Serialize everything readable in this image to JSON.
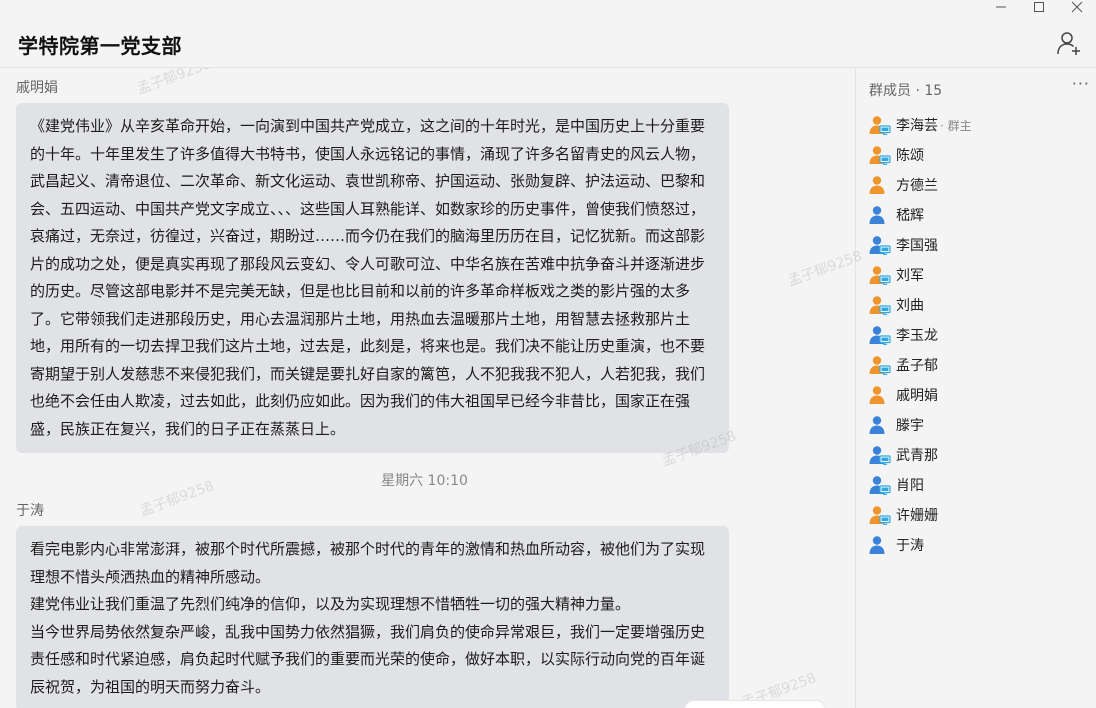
{
  "window": {
    "controls": [
      "minimize",
      "maximize",
      "close"
    ]
  },
  "header": {
    "title": "学特院第一党支部",
    "add_member_icon": "add-user-icon"
  },
  "watermark": "孟子郁9258",
  "messages": [
    {
      "sender": "戚明娟",
      "text": "《建党伟业》从辛亥革命开始，一向演到中国共产党成立，这之间的十年时光，是中国历史上十分重要的十年。十年里发生了许多值得大书特书，使国人永远铭记的事情，涌现了许多名留青史的风云人物，武昌起义、清帝退位、二次革命、新文化运动、袁世凯称帝、护国运动、张勋复辟、护法运动、巴黎和会、五四运动、中国共产党文字成立、、、这些国人耳熟能详、如数家珍的历史事件，曾使我们愤怒过，哀痛过，无奈过，彷徨过，兴奋过，期盼过……而今仍在我们的脑海里历历在目，记忆犹新。而这部影片的成功之处，便是真实再现了那段风云变幻、令人可歌可泣、中华名族在苦难中抗争奋斗并逐渐进步的历史。尽管这部电影并不是完美无缺，但是也比目前和以前的许多革命样板戏之类的影片强的太多了。它带领我们走进那段历史，用心去温润那片土地，用热血去温暖那片土地，用智慧去拯救那片土地，用所有的一切去捍卫我们这片土地，过去是，此刻是，将来也是。我们决不能让历史重演，也不要寄期望于别人发慈悲不来侵犯我们，而关键是要扎好自家的篱笆，人不犯我我不犯人，人若犯我，我们也绝不会任由人欺凌，过去如此，此刻仍应如此。因为我们的伟大祖国早已经今非昔比，国家正在强盛，民族正在复兴，我们的日子正在蒸蒸日上。"
    },
    {
      "timestamp": "星期六 10:10"
    },
    {
      "sender": "于涛",
      "text": "看完电影内心非常澎湃，被那个时代所震撼，被那个时代的青年的激情和热血所动容，被他们为了实现理想不惜头颅洒热血的精神所感动。\n建党伟业让我们重温了先烈们纯净的信仰，以及为实现理想不惜牺牲一切的强大精神力量。\n当今世界局势依然复杂严峻，乱我中国势力依然猖獗，我们肩负的使命异常艰巨，我们一定要增强历史责任感和时代紧迫感，肩负起时代赋予我们的重要而光荣的使命，做好本职，以实际行动向党的百年诞辰祝贺，为祖国的明天而努力奋斗。"
    }
  ],
  "members": {
    "header": "群成员 · 15",
    "more_label": "···",
    "list": [
      {
        "name": "李海芸",
        "role": "· 群主",
        "icon": "user-icon-orange-computer"
      },
      {
        "name": "陈颂",
        "role": "",
        "icon": "user-icon-orange-computer"
      },
      {
        "name": "方德兰",
        "role": "",
        "icon": "user-icon-orange"
      },
      {
        "name": "嵇辉",
        "role": "",
        "icon": "user-icon-blue"
      },
      {
        "name": "李国强",
        "role": "",
        "icon": "user-icon-blue-computer"
      },
      {
        "name": "刘军",
        "role": "",
        "icon": "user-icon-orange-computer"
      },
      {
        "name": "刘曲",
        "role": "",
        "icon": "user-icon-orange-computer"
      },
      {
        "name": "李玉龙",
        "role": "",
        "icon": "user-icon-blue-computer"
      },
      {
        "name": "孟子郁",
        "role": "",
        "icon": "user-icon-orange-computer"
      },
      {
        "name": "戚明娟",
        "role": "",
        "icon": "user-icon-orange"
      },
      {
        "name": "滕宇",
        "role": "",
        "icon": "user-icon-blue"
      },
      {
        "name": "武青那",
        "role": "",
        "icon": "user-icon-blue-computer"
      },
      {
        "name": "肖阳",
        "role": "",
        "icon": "user-icon-blue-computer"
      },
      {
        "name": "许姗姗",
        "role": "",
        "icon": "user-icon-orange-computer"
      },
      {
        "name": "于涛",
        "role": "",
        "icon": "user-icon-blue"
      }
    ]
  },
  "colors": {
    "orange": "#f0952e",
    "blue": "#3a83d8",
    "computer": "#2fa8e0",
    "bubble": "#e1e2e5",
    "background": "#f4f4f4"
  }
}
